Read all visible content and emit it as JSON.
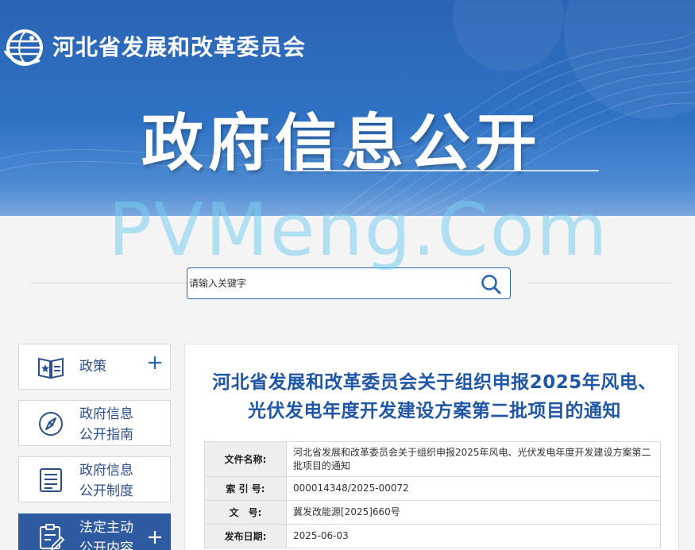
{
  "header": {
    "org_name": "河北省发展和改革委员会",
    "big_title": "政府信息公开",
    "logo_icon": "globe-logo-icon"
  },
  "watermark": "PVMeng.Com",
  "search": {
    "placeholder": "请输入关键字",
    "value": "",
    "icon": "search-icon"
  },
  "sidebar": {
    "items": [
      {
        "label": "政策",
        "icon": "policy-book-icon",
        "expandable": true,
        "active": false
      },
      {
        "label_line1": "政府信息",
        "label_line2": "公开指南",
        "icon": "compass-icon",
        "expandable": false,
        "active": false
      },
      {
        "label_line1": "政府信息",
        "label_line2": "公开制度",
        "icon": "list-document-icon",
        "expandable": false,
        "active": false
      },
      {
        "label_line1": "法定主动",
        "label_line2": "公开内容",
        "icon": "edit-document-icon",
        "expandable": true,
        "active": true
      }
    ]
  },
  "article": {
    "title": "河北省发展和改革委员会关于组织申报2025年风电、光伏发电年度开发建设方案第二批项目的通知",
    "meta": [
      {
        "key": "文件名称:",
        "value": "河北省发展和改革委员会关于组织申报2025年风电、光伏发电年度开发建设方案第二批项目的通知"
      },
      {
        "key": "索 引 号:",
        "value": "000014348/2025-00072"
      },
      {
        "key": "文　号:",
        "value": "冀发改能源[2025]660号"
      },
      {
        "key": "发布日期:",
        "value": "2025-06-03"
      }
    ]
  },
  "colors": {
    "brand_blue": "#2a64b4",
    "title_blue": "#1f57a6",
    "active_bg": "#2d5aa0"
  }
}
